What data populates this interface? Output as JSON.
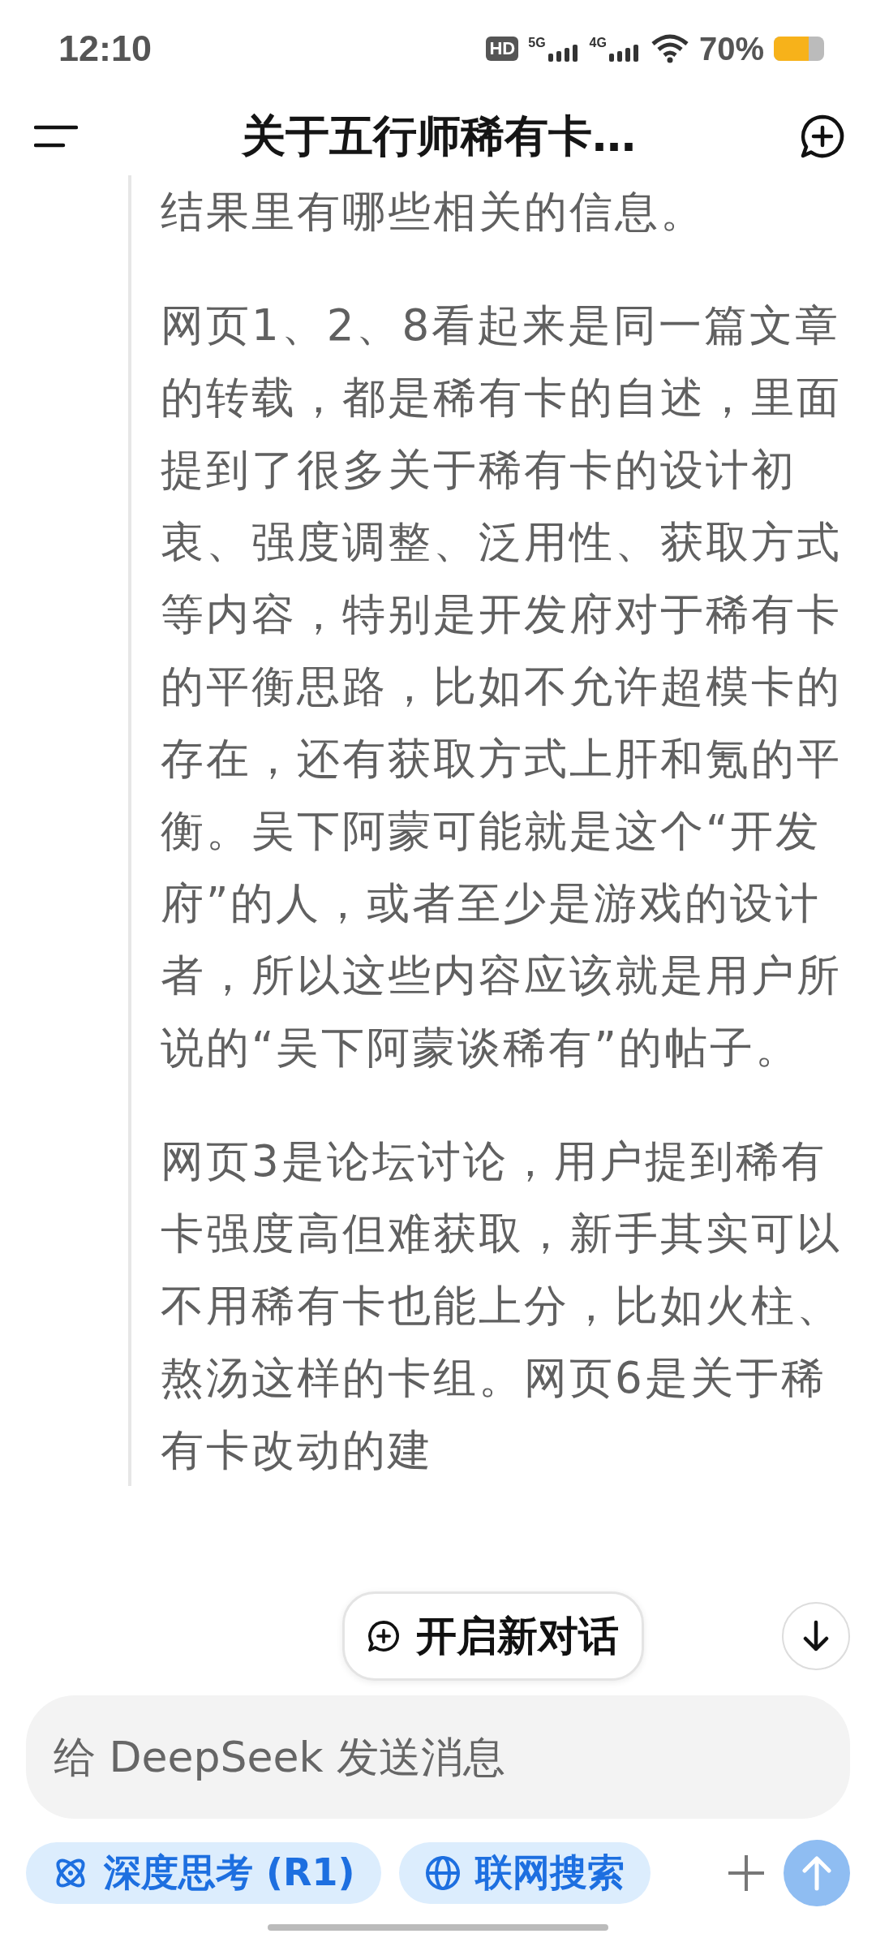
{
  "status_bar": {
    "time": "12:10",
    "hd_badge": "HD",
    "networks": [
      {
        "label": "5G"
      },
      {
        "label": "4G"
      }
    ],
    "battery": "70%"
  },
  "header": {
    "title": "关于五行师稀有卡…"
  },
  "thinking": {
    "paragraphs": [
      "结果里有哪些相关的信息。",
      "网页1、2、8看起来是同一篇文章的转载，都是稀有卡的自述，里面提到了很多关于稀有卡的设计初衷、强度调整、泛用性、获取方式等内容，特别是开发府对于稀有卡的平衡思路，比如不允许超模卡的存在，还有获取方式上肝和氪的平衡。吴下阿蒙可能就是这个“开发府”的人，或者至少是游戏的设计者，所以这些内容应该就是用户所说的“吴下阿蒙谈稀有”的帖子。",
      "网页3是论坛讨论，用户提到稀有卡强度高但难获取，新手其实可以不用稀有卡也能上分，比如火柱、熬汤这样的卡组。网页6是关于稀有卡改动的建"
    ]
  },
  "new_chat_button": {
    "label": "开启新对话"
  },
  "composer": {
    "placeholder": "给 DeepSeek 发送消息",
    "toggles": [
      {
        "kind": "think",
        "label": "深度思考 (R1)",
        "selected": true
      },
      {
        "kind": "web",
        "label": "联网搜索",
        "selected": true
      }
    ],
    "send_disabled": true
  }
}
